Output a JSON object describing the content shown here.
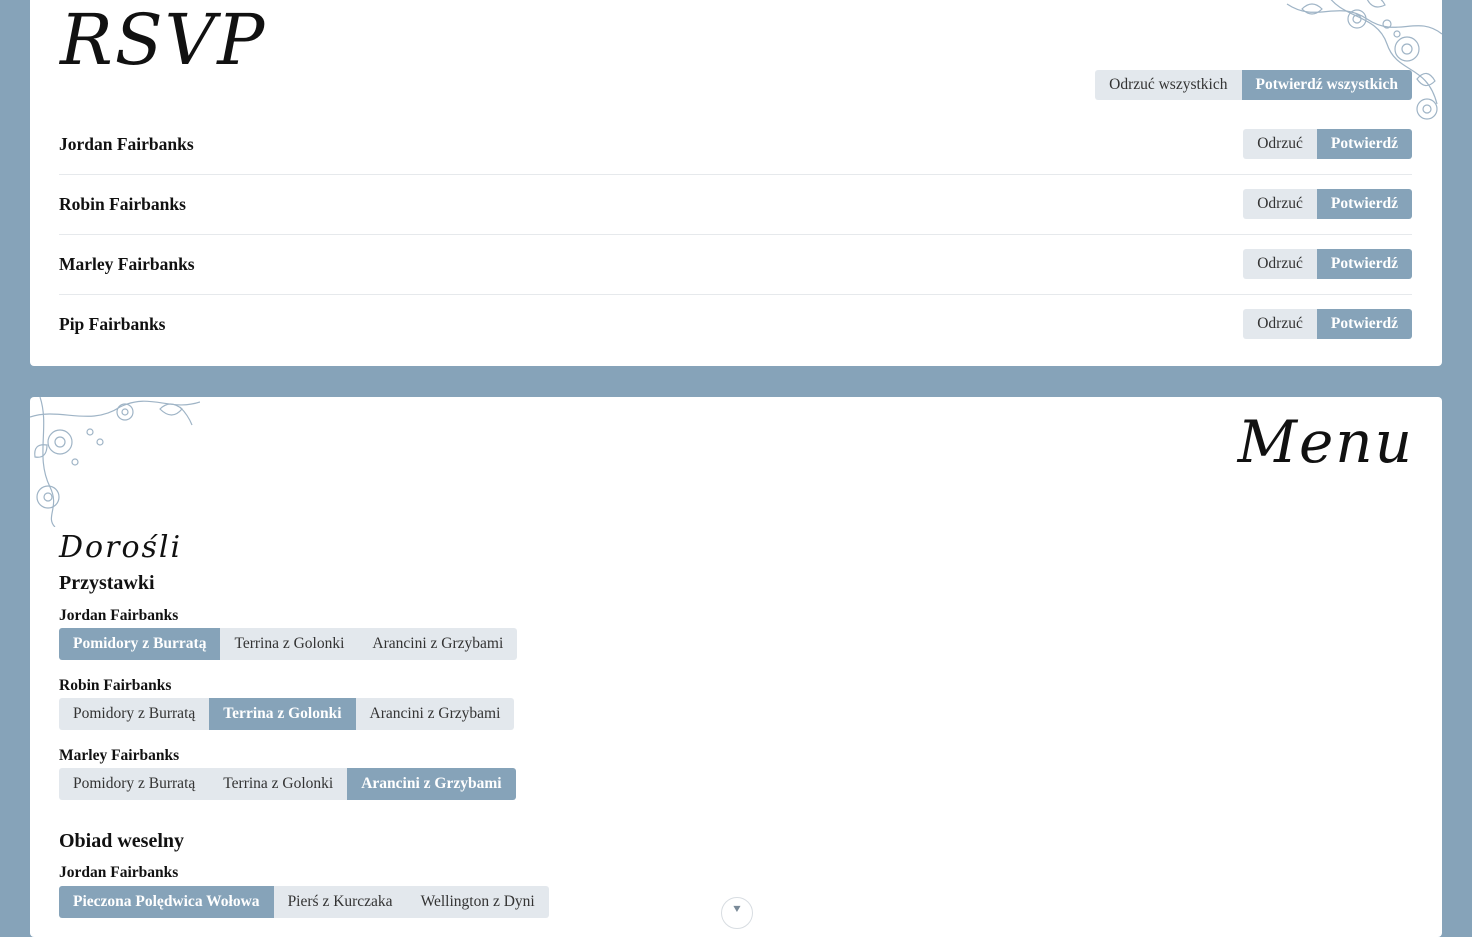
{
  "rsvp": {
    "title": "RSVP",
    "reject_all": "Odrzuć wszystkich",
    "confirm_all": "Potwierdź wszystkich",
    "guests": [
      {
        "name": "Jordan Fairbanks",
        "reject": "Odrzuć",
        "confirm": "Potwierdź"
      },
      {
        "name": "Robin Fairbanks",
        "reject": "Odrzuć",
        "confirm": "Potwierdź"
      },
      {
        "name": "Marley Fairbanks",
        "reject": "Odrzuć",
        "confirm": "Potwierdź"
      },
      {
        "name": "Pip Fairbanks",
        "reject": "Odrzuć",
        "confirm": "Potwierdź"
      }
    ]
  },
  "menu": {
    "title": "Menu",
    "adults_title": "Dorośli",
    "starters": {
      "heading": "Przystawki",
      "choices": [
        {
          "guest": "Jordan Fairbanks",
          "options": [
            "Pomidory z Burratą",
            "Terrina z Golonki",
            "Arancini z Grzybami"
          ],
          "selected": 0
        },
        {
          "guest": "Robin Fairbanks",
          "options": [
            "Pomidory z Burratą",
            "Terrina z Golonki",
            "Arancini z Grzybami"
          ],
          "selected": 1
        },
        {
          "guest": "Marley Fairbanks",
          "options": [
            "Pomidory z Burratą",
            "Terrina z Golonki",
            "Arancini z Grzybami"
          ],
          "selected": 2
        }
      ]
    },
    "main": {
      "heading": "Obiad weselny",
      "choices": [
        {
          "guest": "Jordan Fairbanks",
          "options": [
            "Pieczona Polędwica Wołowa",
            "Pierś z Kurczaka",
            "Wellington z Dyni"
          ],
          "selected": 0
        }
      ]
    }
  },
  "colors": {
    "accent": "#86a3b9",
    "button_bg": "#e3e8ed",
    "card": "#ffffff"
  },
  "icons": {
    "scroll": "chevron-down-icon",
    "floral": "floral-ornament"
  }
}
